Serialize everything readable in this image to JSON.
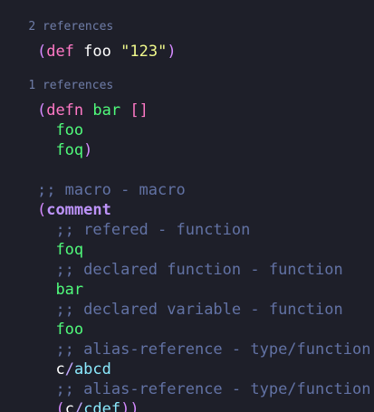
{
  "lens": {
    "foo_refs": "2 references",
    "bar_refs": "1 references"
  },
  "code": {
    "l1_open": "(",
    "l1_def": "def",
    "l1_sym": "foo",
    "l1_str": "\"123\"",
    "l1_close": ")",
    "l2_open": "(",
    "l2_defn": "defn",
    "l2_sym": "bar",
    "l2_vec": "[]",
    "l3_foo": "foo",
    "l4_foq": "foq",
    "l4_close": ")",
    "l5_comment": ";; macro - macro",
    "l6_open": "(",
    "l6_comment_kw": "comment",
    "l7_comment": ";; refered - function",
    "l8_foq": "foq",
    "l9_comment": ";; declared function - function",
    "l10_bar": "bar",
    "l11_comment": ";; declared variable - function",
    "l12_foo": "foo",
    "l13_comment": ";; alias-reference - type/function",
    "l14_ns": "c",
    "l14_slash": "/",
    "l14_fn": "abcd",
    "l15_comment": ";; alias-reference - type/function",
    "l16_open": "(",
    "l16_ns": "c",
    "l16_slash": "/",
    "l16_fn": "cdef",
    "l16_close1": ")",
    "l16_close2": ")"
  }
}
